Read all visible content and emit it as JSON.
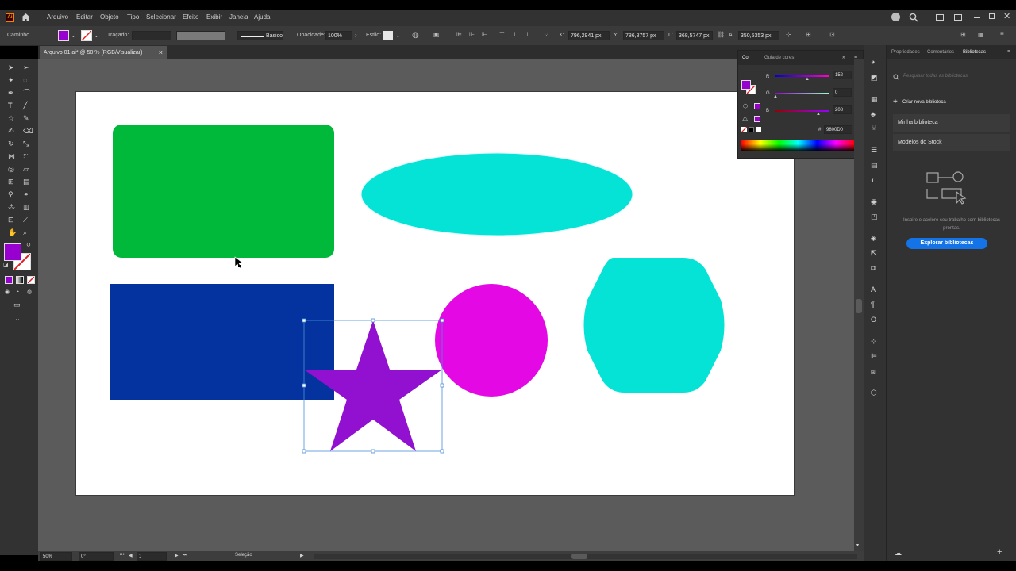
{
  "app": {
    "logo": "Ai"
  },
  "menu": [
    "Arquivo",
    "Editar",
    "Objeto",
    "Tipo",
    "Selecionar",
    "Efeito",
    "Exibir",
    "Janela",
    "Ajuda"
  ],
  "control_bar": {
    "path_label": "Caminho",
    "stroke_label": "Traçado:",
    "profile_label": "Básico",
    "opacity_label": "Opacidade:",
    "opacity_value": "100%",
    "style_label": "Estilo:",
    "x_label": "X:",
    "x_value": "796,2941 px",
    "y_label": "Y:",
    "y_value": "786,8757 px",
    "w_label": "L:",
    "w_value": "368,5747 px",
    "h_label": "A:",
    "h_value": "350,5353 px"
  },
  "document_tab": {
    "title": "Arquivo 01.ai* @ 50 % (RGB/Visualizar)",
    "close": "×"
  },
  "color_panel": {
    "tabs": [
      "Cor",
      "Guia de cores"
    ],
    "r_label": "R",
    "r_value": "152",
    "g_label": "G",
    "g_value": "0",
    "b_label": "B",
    "b_value": "208",
    "hex_label": "#",
    "hex_value": "9800D0"
  },
  "right_panel": {
    "tabs": [
      "Propriedades",
      "Comentários",
      "Bibliotecas"
    ],
    "search_placeholder": "Pesquisar todas as bibliotecas",
    "create_library": "Criar nova biblioteca",
    "libraries": [
      "Minha biblioteca",
      "Modelos do Stock"
    ],
    "empty_text": "Inspire e acelere seu trabalho com bibliotecas prontas.",
    "explore_button": "Explorar bibliotecas"
  },
  "status_bar": {
    "zoom": "50%",
    "rotation": "0°",
    "artboard_number": "1",
    "tool_name": "Seleção"
  },
  "colors": {
    "fill": "#9800D0",
    "green_rect": "#00B93A",
    "cyan": "#05E2D6",
    "blue_rect": "#0433A0",
    "magenta_circle": "#E408E4",
    "star": "#9210D0",
    "accent_button": "#1473E6"
  }
}
